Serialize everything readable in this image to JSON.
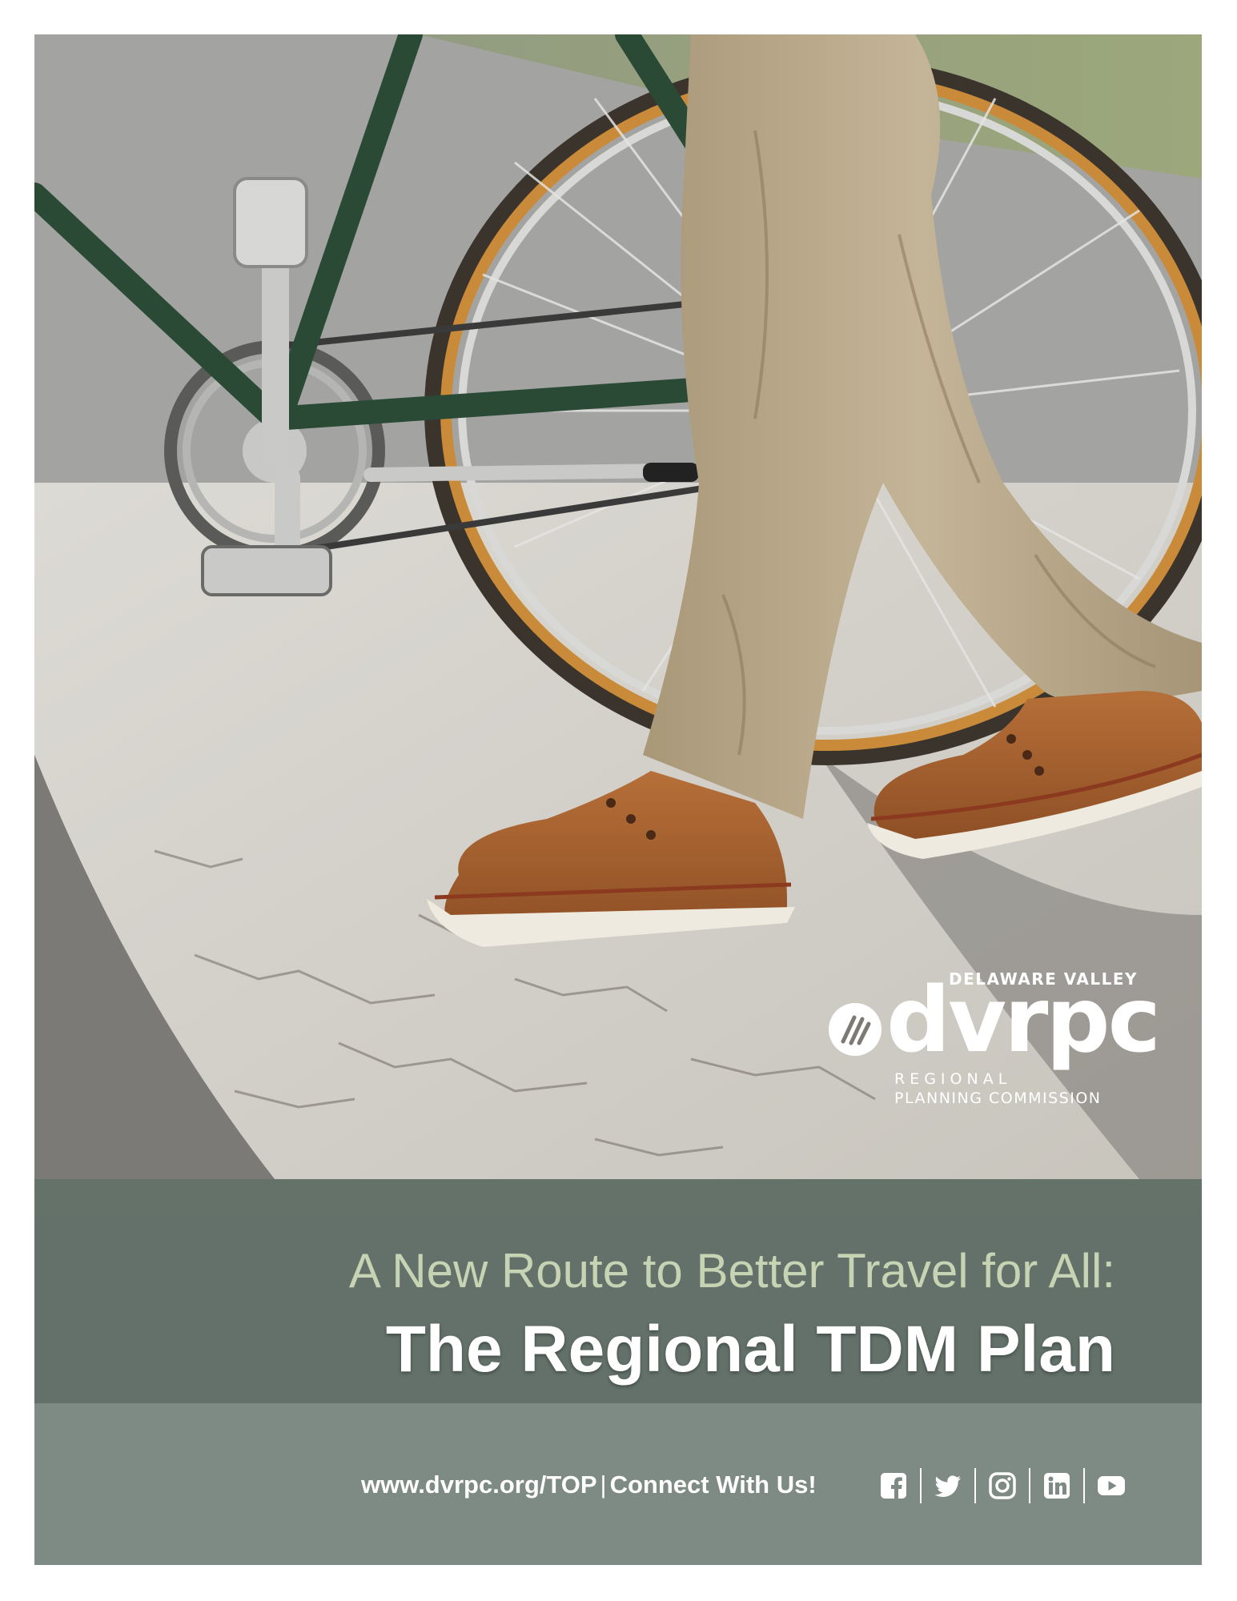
{
  "logo": {
    "top_line": "DELAWARE VALLEY",
    "wordmark": "dvrpc",
    "line_regional": "REGIONAL",
    "line_commission": "PLANNING COMMISSION"
  },
  "title": {
    "subtitle": "A New Route to Better Travel for All:",
    "main": "The Regional TDM Plan"
  },
  "footer": {
    "url": "www.dvrpc.org/TOP",
    "separator": "|",
    "connect": "Connect With Us!",
    "social_icons": [
      "facebook-icon",
      "twitter-icon",
      "instagram-icon",
      "linkedin-icon",
      "youtube-icon"
    ]
  },
  "colors": {
    "subtitle": "#c7d4b3",
    "title_band": "#607068",
    "footer_band": "#7e8a84",
    "shoe": "#a9622f",
    "pants": "#bcab8d",
    "bike_frame": "#2a4a36",
    "tire": "#c98a3a"
  }
}
